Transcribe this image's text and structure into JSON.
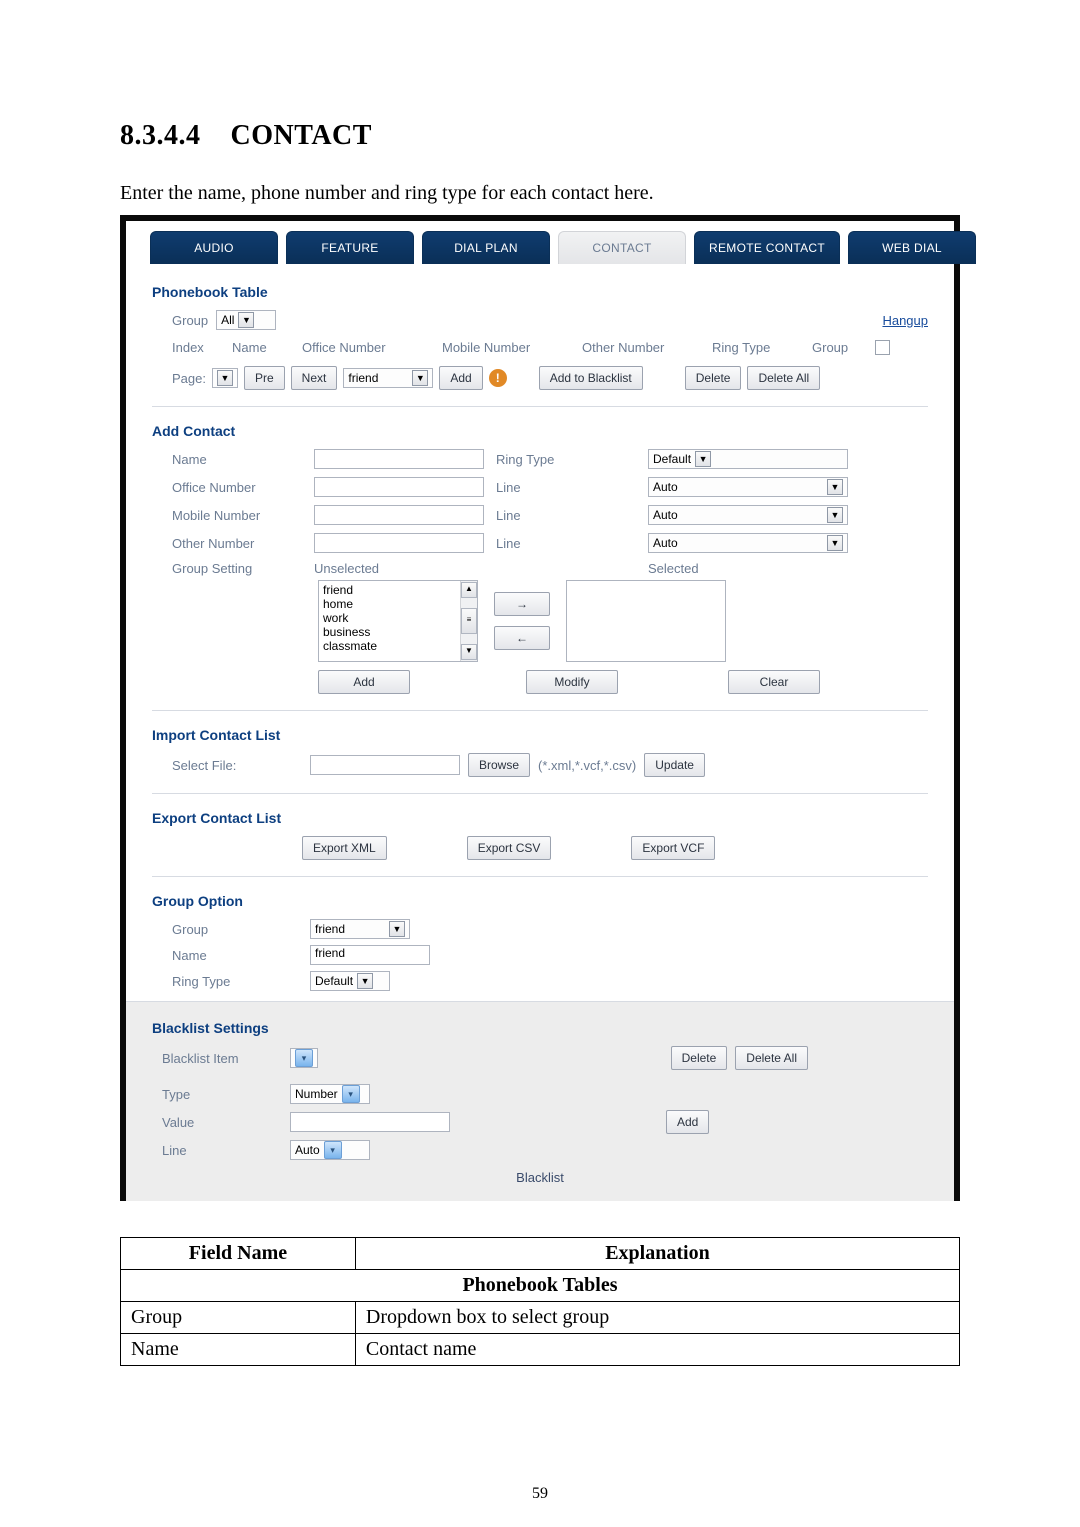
{
  "heading": {
    "number": "8.3.4.4",
    "title": "CONTACT"
  },
  "intro": "Enter the name, phone number and ring type for each contact here.",
  "tabs": [
    {
      "label": "AUDIO",
      "active": true
    },
    {
      "label": "FEATURE",
      "active": true
    },
    {
      "label": "DIAL PLAN",
      "active": true
    },
    {
      "label": "CONTACT",
      "active": false
    },
    {
      "label": "REMOTE CONTACT",
      "active": true
    },
    {
      "label": "WEB DIAL",
      "active": true
    }
  ],
  "phonebook": {
    "title": "Phonebook Table",
    "group_label": "Group",
    "group_value": "All",
    "hangup": "Hangup",
    "headers": [
      "Index",
      "Name",
      "Office Number",
      "Mobile Number",
      "Other Number",
      "Ring Type",
      "Group"
    ],
    "page_label": "Page:",
    "pre": "Pre",
    "next": "Next",
    "search_value": "friend",
    "add": "Add",
    "add_to_blacklist": "Add to Blacklist",
    "delete": "Delete",
    "delete_all": "Delete All"
  },
  "add_contact": {
    "title": "Add Contact",
    "rows": {
      "name": {
        "label": "Name",
        "rt_label": "Ring Type",
        "rt_value": "Default"
      },
      "office": {
        "label": "Office Number",
        "line_label": "Line",
        "line_value": "Auto"
      },
      "mobile": {
        "label": "Mobile Number",
        "line_label": "Line",
        "line_value": "Auto"
      },
      "other": {
        "label": "Other Number",
        "line_label": "Line",
        "line_value": "Auto"
      },
      "group_setting": {
        "label": "Group Setting",
        "unselected_label": "Unselected",
        "selected_label": "Selected",
        "available_groups": [
          "friend",
          "home",
          "work",
          "business",
          "classmate"
        ]
      }
    },
    "buttons": {
      "add": "Add",
      "modify": "Modify",
      "clear": "Clear"
    },
    "arrows": {
      "right": "→",
      "left": "←"
    }
  },
  "import_list": {
    "title": "Import Contact List",
    "select_file": "Select File:",
    "browse": "Browse",
    "filetypes": "(*.xml,*.vcf,*.csv)",
    "update": "Update"
  },
  "export_list": {
    "title": "Export Contact List",
    "xml": "Export XML",
    "csv": "Export CSV",
    "vcf": "Export VCF"
  },
  "group_option": {
    "title": "Group Option",
    "group_label": "Group",
    "group_value": "friend",
    "name_label": "Name",
    "name_value": "friend",
    "rt_label": "Ring Type",
    "rt_value": "Default"
  },
  "blacklist": {
    "title": "Blacklist Settings",
    "item_label": "Blacklist Item",
    "delete": "Delete",
    "delete_all": "Delete All",
    "type_label": "Type",
    "type_value": "Number",
    "value_label": "Value",
    "add": "Add",
    "line_label": "Line",
    "line_value": "Auto",
    "footer": "Blacklist"
  },
  "table": {
    "h1": "Field Name",
    "h2": "Explanation",
    "section": "Phonebook Tables",
    "rows": [
      {
        "field": "Group",
        "explain": "Dropdown box to select group"
      },
      {
        "field": "Name",
        "explain": "Contact name"
      }
    ]
  },
  "page_number": "59"
}
